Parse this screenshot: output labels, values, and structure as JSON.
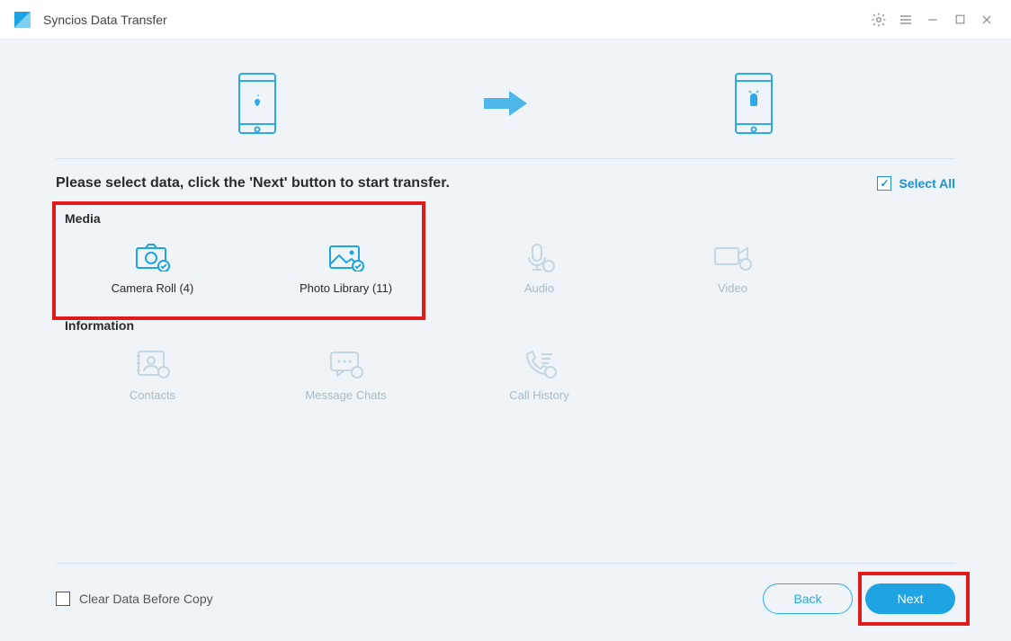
{
  "app": {
    "title": "Syncios Data Transfer"
  },
  "instruction": "Please select data, click the 'Next' button to start transfer.",
  "select_all_label": "Select All",
  "sections": {
    "media": {
      "title": "Media",
      "camera_roll": "Camera Roll (4)",
      "photo_library": "Photo Library (11)",
      "audio": "Audio",
      "video": "Video"
    },
    "information": {
      "title": "Information",
      "contacts": "Contacts",
      "message_chats": "Message Chats",
      "call_history": "Call History"
    }
  },
  "footer": {
    "clear_label": "Clear Data Before Copy",
    "back": "Back",
    "next": "Next"
  },
  "colors": {
    "accent": "#1ea4e3",
    "highlight": "#e11a1a",
    "panel_bg": "#eef4f8",
    "inactive": "#a9bac6"
  }
}
